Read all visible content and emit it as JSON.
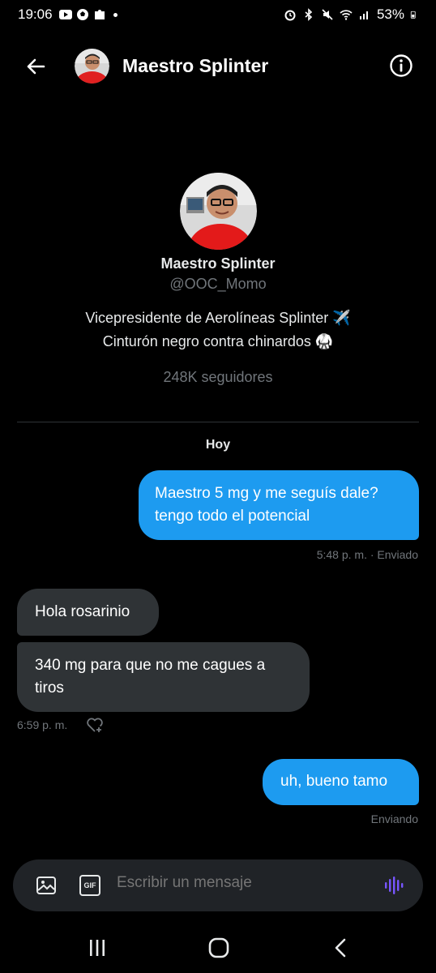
{
  "status_bar": {
    "time": "19:06",
    "battery": "53%",
    "left_icons": [
      "youtube-icon",
      "soccer-icon",
      "puzzle-icon"
    ],
    "right_icons": [
      "alarm-icon",
      "bluetooth-icon",
      "mute-icon",
      "wifi-icon",
      "signal-icon",
      "battery-icon"
    ]
  },
  "header": {
    "title": "Maestro Splinter"
  },
  "profile": {
    "name": "Maestro Splinter",
    "handle": "@OOC_Momo",
    "bio_line1": "Vicepresidente de Aerolíneas Splinter ✈️",
    "bio_line2": "Cinturón negro contra chinardos 🥋",
    "followers": "248K seguidores"
  },
  "conversation": {
    "day_label": "Hoy",
    "messages": [
      {
        "direction": "sent",
        "lines": [
          "Maestro 5 mg y me seguís dale?",
          "tengo todo el potencial"
        ],
        "meta": "5:48 p. m. · Enviado"
      },
      {
        "direction": "received",
        "lines": [
          "Hola rosarinio"
        ]
      },
      {
        "direction": "received",
        "lines": [
          "340 mg para que no me cagues a",
          "tiros"
        ],
        "meta": "6:59 p. m."
      },
      {
        "direction": "sent",
        "lines": [
          "uh, bueno tamo"
        ],
        "meta": "Enviando"
      }
    ]
  },
  "composer": {
    "placeholder": "Escribir un mensaje",
    "gif_label": "GIF"
  },
  "colors": {
    "accent": "#1d9bf0",
    "received_bubble": "#2f3336",
    "voice": "#7856ff"
  }
}
